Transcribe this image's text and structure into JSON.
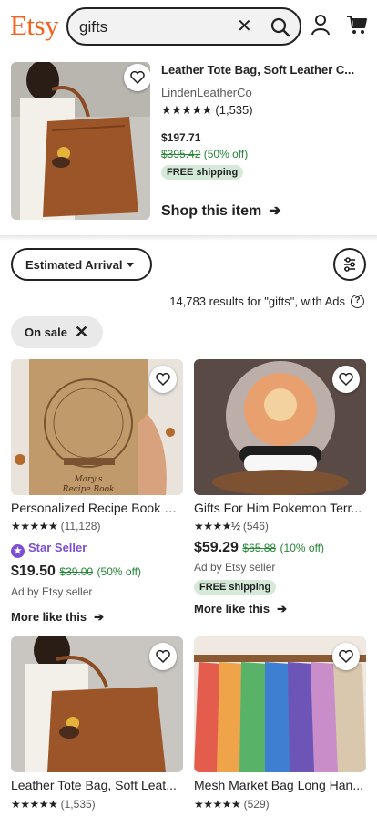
{
  "header": {
    "logo": "Etsy",
    "search_value": "gifts"
  },
  "featured": {
    "title": "Leather Tote Bag, Soft Leather C...",
    "shop": "LindenLeatherCo",
    "stars": "★★★★★",
    "review_count": "(1,535)",
    "price": "$197.71",
    "original_price": "$395.42",
    "discount": "(50% off)",
    "free_shipping": "FREE shipping",
    "cta": "Shop this item"
  },
  "filters": {
    "sort_label": "Estimated Arrival",
    "results_text": "14,783 results for \"gifts\", with Ads",
    "help": "?",
    "chip_label": "On sale"
  },
  "listings": [
    {
      "title": "Personalized Recipe Book B...",
      "stars": "★★★★★",
      "reviews": "(11,128)",
      "badge": "Star Seller",
      "price": "$19.50",
      "original_price": "$39.00",
      "discount": "(50% off)",
      "ad_text": "Ad by Etsy seller",
      "more": "More like this",
      "image_label": "Mary's Recipe Book"
    },
    {
      "title": "Gifts For Him Pokemon Terr...",
      "stars": "★★★★½",
      "reviews": "(546)",
      "price": "$59.29",
      "original_price": "$65.88",
      "discount": "(10% off)",
      "ad_text": "Ad by Etsy seller",
      "free_shipping": "FREE shipping",
      "more": "More like this"
    },
    {
      "title": "Leather Tote Bag, Soft Leat...",
      "stars": "★★★★★",
      "reviews": "(1,535)"
    },
    {
      "title": "Mesh Market Bag Long Han...",
      "stars": "★★★★★",
      "reviews": "(529)"
    }
  ],
  "colors": {
    "brand": "#F1641E",
    "sale_green": "#258635",
    "star_seller": "#7b4fd8"
  }
}
